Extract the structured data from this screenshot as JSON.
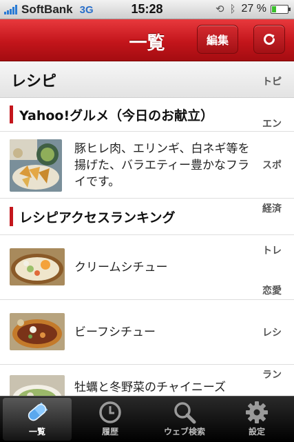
{
  "status_bar": {
    "carrier": "SoftBank",
    "network": "3G",
    "time": "15:28",
    "battery": "27 %",
    "battery_level": 0.27
  },
  "nav": {
    "title": "一覧",
    "edit_label": "編集"
  },
  "section": {
    "title": "レシピ"
  },
  "side_tabs": [
    "トピ",
    "エン",
    "スポ",
    "経済",
    "トレ",
    "恋愛",
    "レシ",
    "ラン"
  ],
  "list": {
    "group1_title": "Yahoo!グルメ（今日のお献立）",
    "item1_text": "豚ヒレ肉、エリンギ、白ネギ等を揚げた、バラエティー豊かなフライです。",
    "group2_title": "レシピアクセスランキング",
    "item2_text": "クリームシチュー",
    "item3_text": "ビーフシチュー",
    "item4_text": "牡蠣と冬野菜のチャイニーズ"
  },
  "tabs": {
    "list": "一覧",
    "history": "履歴",
    "search": "ウェブ検索",
    "settings": "設定"
  },
  "icons": [
    "signal-icon",
    "lock-rotation-icon",
    "bluetooth-icon",
    "battery-icon",
    "refresh-icon",
    "pill-icon",
    "clock-icon",
    "magnifier-icon",
    "gear-icon"
  ]
}
